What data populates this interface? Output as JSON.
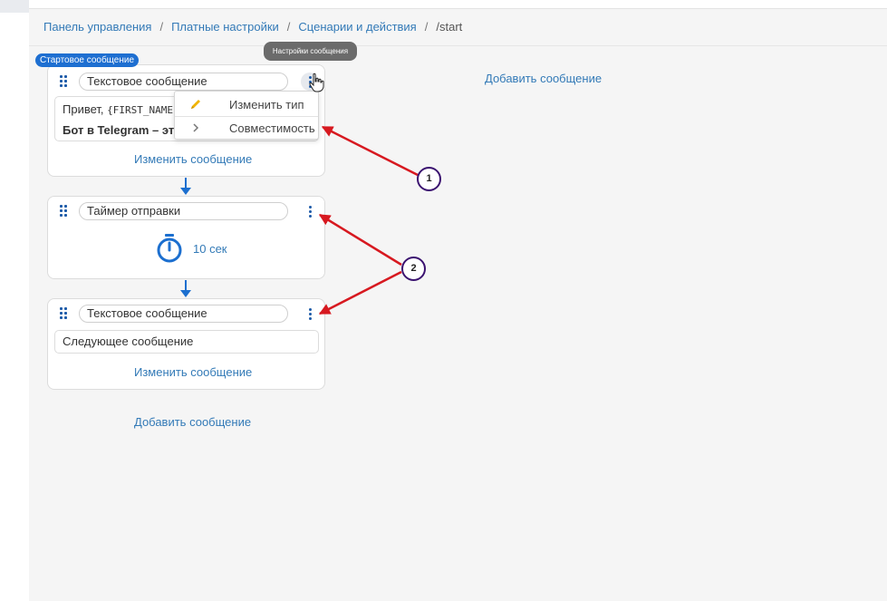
{
  "breadcrumb": {
    "items": [
      "Панель управления",
      "Платные настройки",
      "Сценарии и действия"
    ],
    "separator": "/",
    "current": "/start"
  },
  "start_badge": "Стартовое сообщение",
  "tooltip": "Настройки сообщения",
  "add_message_label": "Добавить сообщение",
  "cards": [
    {
      "type_label": "Текстовое сообщение",
      "text_line1_prefix": "Привет, ",
      "text_line1_var": "{FIRST_NAME}",
      "text_line2": "Бот в Telegram – это и",
      "edit_label": "Изменить сообщение"
    },
    {
      "type_label": "Таймер отправки",
      "timer_value": "10 сек"
    },
    {
      "type_label": "Текстовое сообщение",
      "text": "Следующее сообщение",
      "edit_label": "Изменить сообщение"
    }
  ],
  "dropdown": {
    "items": [
      {
        "label": "Изменить тип",
        "icon": "pencil-icon"
      },
      {
        "label": "Совместимость",
        "icon": "chevron-right-icon"
      }
    ]
  },
  "callouts": [
    "1",
    "2"
  ],
  "colors": {
    "accent": "#337ab7",
    "badge": "#1e6fd1",
    "annotation_arrow": "#d71920",
    "callout_border": "#3b1270",
    "pencil": "#f0b400"
  }
}
